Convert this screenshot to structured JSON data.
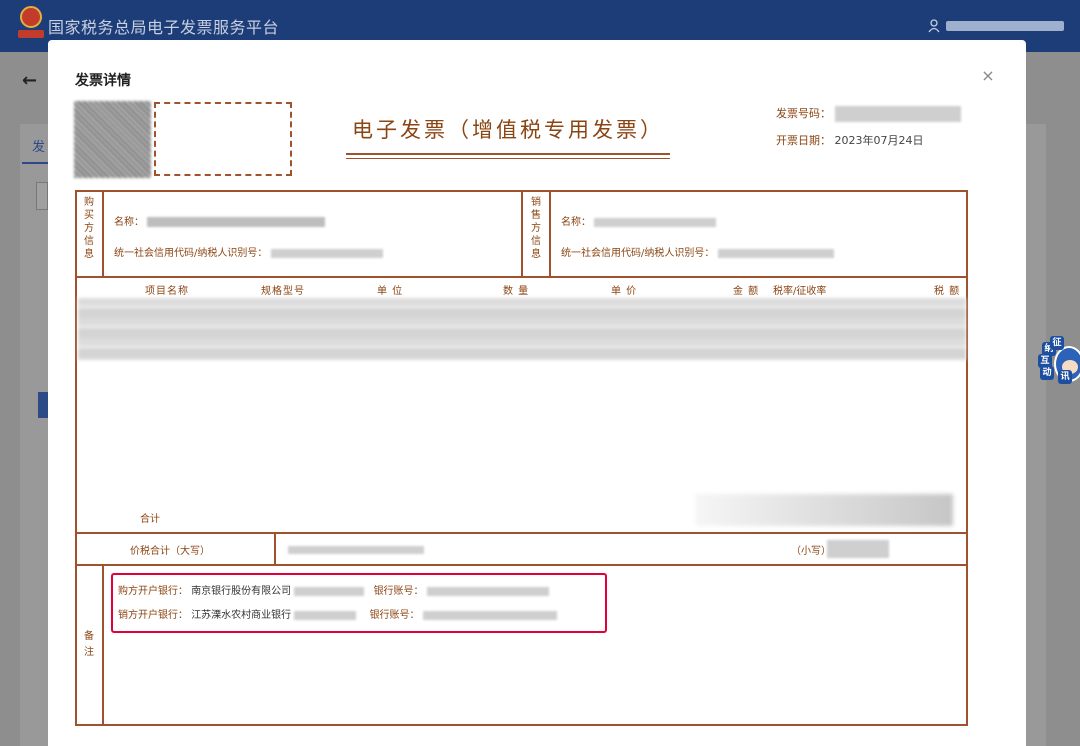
{
  "app": {
    "site_title": "国家税务总局电子发票服务平台",
    "background_tab": "发",
    "back_arrow": "←"
  },
  "modal": {
    "title": "发票详情",
    "close_symbol": "×"
  },
  "invoice": {
    "title": "电子发票（增值税专用发票）",
    "number_label": "发票号码：",
    "date_label": "开票日期：",
    "date_value": "2023年07月24日",
    "buyer_side_label": "购买方信息",
    "seller_side_label": "销售方信息",
    "name_label": "名称：",
    "tax_id_label": "统一社会信用代码/纳税人识别号：",
    "columns": {
      "item": "项目名称",
      "spec": "规格型号",
      "unit": "单 位",
      "qty": "数 量",
      "price": "单 价",
      "amount": "金 额",
      "rate": "税率/征收率",
      "tax": "税 额"
    },
    "total_label": "合计",
    "price_tax_total_label": "价税合计（大写）",
    "small_label": "（小写）",
    "remarks_label": "备注",
    "remarks": {
      "buyer_bank_label": "购方开户银行：",
      "buyer_bank_value": "南京银行股份有限公司",
      "seller_bank_label": "销方开户银行：",
      "seller_bank_value": "江苏溧水农村商业银行",
      "account_label": "银行账号："
    }
  },
  "side_widget": {
    "chars": [
      "纳",
      "征",
      "互",
      "动",
      "讯"
    ]
  },
  "colors": {
    "header_blue": "#1d3d78",
    "invoice_brown": "#a0522d",
    "highlight_red": "#e0003c"
  }
}
